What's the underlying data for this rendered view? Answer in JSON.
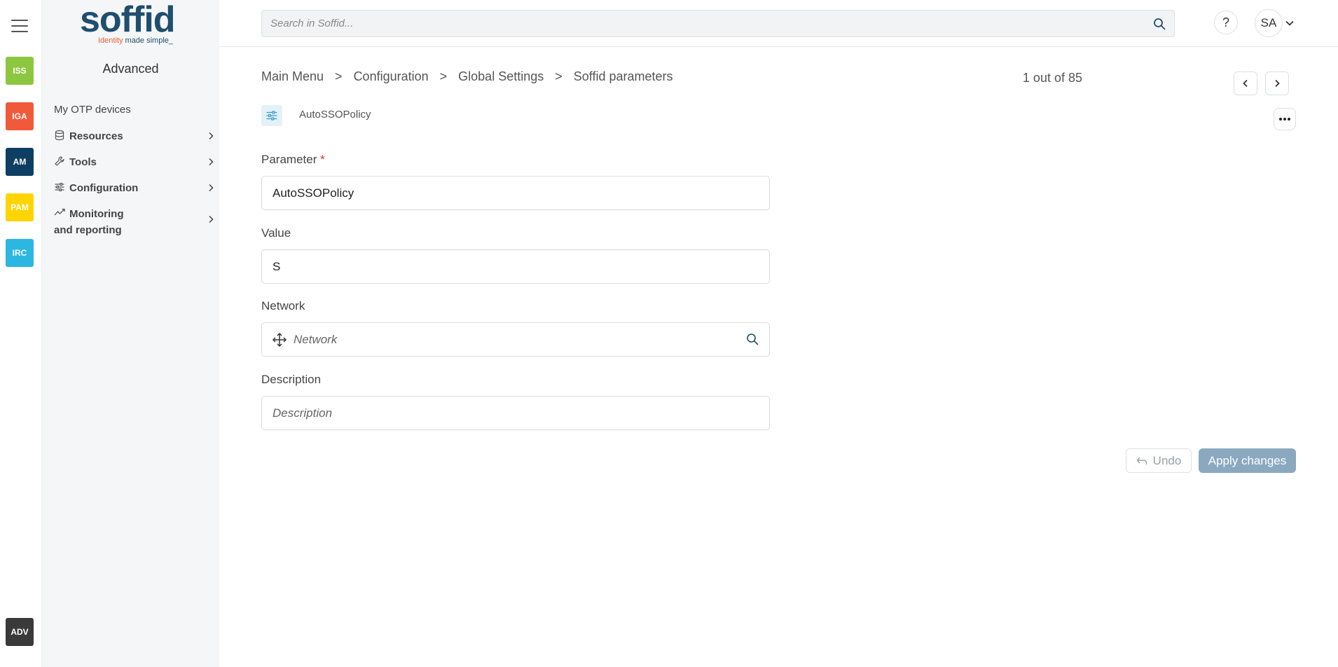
{
  "rail": {
    "apps": [
      {
        "label": "ISS",
        "color": "#8dc63f"
      },
      {
        "label": "IGA",
        "color": "#f05a3a"
      },
      {
        "label": "AM",
        "color": "#0e3f63"
      },
      {
        "label": "PAM",
        "color": "#ffd400"
      },
      {
        "label": "IRC",
        "color": "#2bb7e0"
      },
      {
        "label": "ADV",
        "color": "#3a3a3a"
      }
    ]
  },
  "logo": {
    "word": "soffid",
    "tag_red": "Identity",
    "tag_rest": " made simple_"
  },
  "sidebar": {
    "title": "Advanced",
    "items": [
      {
        "label": "My OTP devices",
        "icon": "none"
      },
      {
        "label": "Resources",
        "icon": "database-icon"
      },
      {
        "label": "Tools",
        "icon": "wrench-icon"
      },
      {
        "label": "Configuration",
        "icon": "sliders-icon"
      },
      {
        "label": "Monitoring and reporting",
        "icon": "chart-line-icon"
      }
    ]
  },
  "topbar": {
    "search_placeholder": "Search in Soffid...",
    "help_label": "?",
    "user_initials": "SA"
  },
  "breadcrumb": [
    "Main Menu",
    "Configuration",
    "Global Settings",
    "Soffid parameters"
  ],
  "breadcrumb_sep": ">",
  "pager": {
    "text": "1 out of 85"
  },
  "record": {
    "title": "AutoSSOPolicy"
  },
  "form": {
    "parameter": {
      "label": "Parameter",
      "required_mark": "*",
      "value": "AutoSSOPolicy"
    },
    "value": {
      "label": "Value",
      "value": "S"
    },
    "network": {
      "label": "Network",
      "placeholder": "Network"
    },
    "description": {
      "label": "Description",
      "placeholder": "Description"
    }
  },
  "buttons": {
    "undo": "Undo",
    "apply": "Apply changes"
  }
}
